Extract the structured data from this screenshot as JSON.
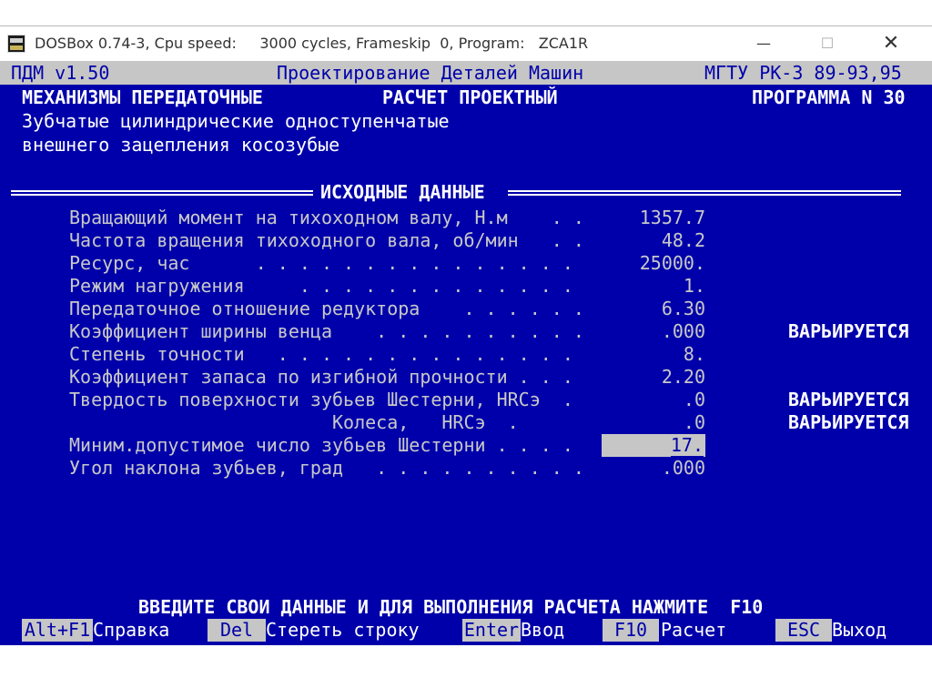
{
  "window": {
    "title": "DOSBox 0.74-3, Cpu speed:     3000 cycles, Frameskip  0, Program:   ZCA1R",
    "controls": {
      "minimize": "—",
      "maximize": "☐",
      "close": "✕"
    }
  },
  "header": {
    "left": "ПДМ v1.50",
    "center": "Проектирование Деталей Машин",
    "right": "МГТУ РК-3 89-93,95"
  },
  "subheader": {
    "left": "МЕХАНИЗМЫ ПЕРЕДАТОЧНЫЕ",
    "center": "РАСЧЕТ ПРОЕКТНЫЙ",
    "right": "ПРОГРАММА N 30"
  },
  "description": {
    "line1": "Зубчатые цилиндрические одноступенчатые",
    "line2": "внешнего зацепления косозубые"
  },
  "section_title": "ИСХОДНЫЕ ДАННЫЕ",
  "params": [
    {
      "label": "Вращающий момент на тихоходном валу, Н.м    . .",
      "value": "1357.7",
      "note": ""
    },
    {
      "label": "Частота вращения тихоходного вала, об/мин   . .",
      "value": "48.2",
      "note": ""
    },
    {
      "label": "Ресурс, час      . . . . . . . . . . . . . . .",
      "value": "25000.",
      "note": ""
    },
    {
      "label": "Режим нагружения     . . . . . . . . . . . . .",
      "value": "1.",
      "note": ""
    },
    {
      "label": "Передаточное отношение редуктора    . . . . . .",
      "value": "6.30",
      "note": ""
    },
    {
      "label": "Коэффициент ширины венца    . . . . . . . . . .",
      "value": ".000",
      "note": "ВАРЬИРУЕТСЯ"
    },
    {
      "label": "Степень точности   . . . . . . . . . . . . . .",
      "value": "8.",
      "note": ""
    },
    {
      "label": "Коэффициент запаса по изгибной прочности . . .",
      "value": "2.20",
      "note": ""
    },
    {
      "label": "Твердость поверхности зубьев Шестерни, HRCэ  .",
      "value": ".0",
      "note": "ВАРЬИРУЕТСЯ"
    },
    {
      "label": "                        Колеса,   HRCэ  .",
      "value": ".0",
      "note": "ВАРЬИРУЕТСЯ"
    },
    {
      "label": "Миним.допустимое число зубьев Шестерни . . . .",
      "value": "17.",
      "note": ""
    },
    {
      "label": "Угол наклона зубьев, град   . . . . . . . . . .",
      "value": ".000",
      "note": ""
    }
  ],
  "prompt": "ВВЕДИТЕ СВОИ ДАННЫЕ И ДЛЯ ВЫПОЛНЕНИЯ РАСЧЕТА НАЖМИТЕ  F10",
  "fkeys": [
    {
      "key": "Alt+F1",
      "label": "Справка"
    },
    {
      "key": "Del",
      "label": "Стереть строку"
    },
    {
      "key": "Enter",
      "label": "Ввод"
    },
    {
      "key": "F10",
      "label": "Расчет"
    },
    {
      "key": "ESC",
      "label": "Выход"
    }
  ],
  "colors": {
    "screen": "#0000aa",
    "bar": "#c6c6c6",
    "text": "#ffffff",
    "dim": "#c8c8c8"
  }
}
